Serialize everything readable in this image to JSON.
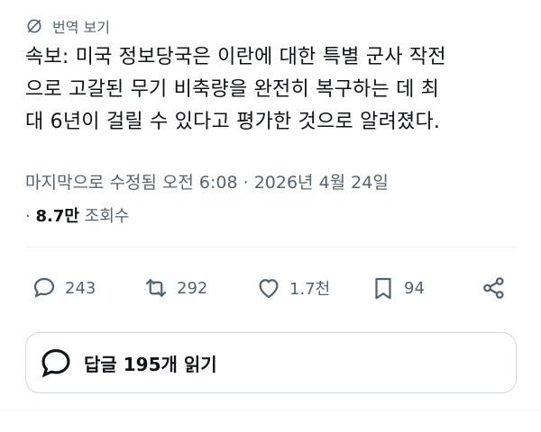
{
  "translate": {
    "label": "번역 보기",
    "icon": "globe-slash-icon"
  },
  "tweet": {
    "text": "속보: 미국 정보당국은 이란에 대한 특별 군사 작전\n으로 고갈된 무기 비축량을 완전히 복구하는 데 최\n대 6년이 걸릴 수 있다고 평가한 것으로 알려졌다.",
    "edited_meta": "마지막으로 수정됨 오전 6:08 · 2026년 4월 24일",
    "views_prefix": "· ",
    "views_count": "8.7만",
    "views_label": "조회수"
  },
  "actions": {
    "replies": "243",
    "reposts": "292",
    "likes": "1.7천",
    "bookmarks": "94"
  },
  "read_replies": {
    "label": "답글 195개 읽기"
  },
  "colors": {
    "text": "#0f1419",
    "secondary": "#536471",
    "border": "#cfd9de"
  }
}
